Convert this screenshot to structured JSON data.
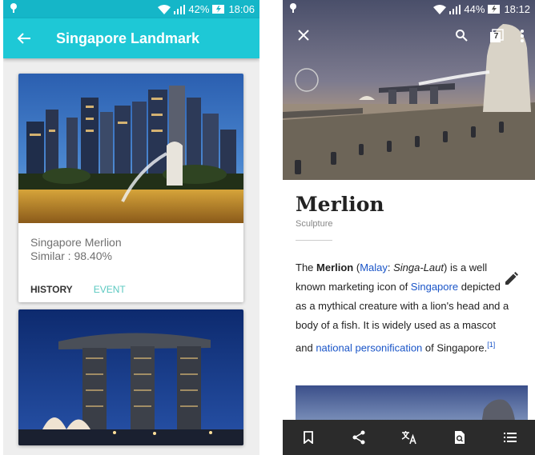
{
  "left_screen": {
    "status": {
      "signal_text": "42%",
      "time": "18:06"
    },
    "appbar": {
      "title": "Singapore Landmark",
      "back_icon": "arrow-back-icon"
    },
    "cards": [
      {
        "name": "Singapore Merlion",
        "similarity": "Similar : 98.40%",
        "actions": [
          "HISTORY",
          "EVENT"
        ]
      },
      {
        "photo": "marina-bay-sands"
      }
    ],
    "colors": {
      "appbar": "#1ec8d6",
      "statusbar": "#15b6c8",
      "event_text": "#5ac8c0"
    }
  },
  "right_screen": {
    "status": {
      "signal_text": "44%",
      "time": "18:12"
    },
    "top_icons": [
      "close-icon",
      "search-icon",
      "tabs-icon",
      "more-icon"
    ],
    "tabs_count": "7",
    "article": {
      "title": "Merlion",
      "subtitle": "Sculpture",
      "body": {
        "p1": "The ",
        "bold": "Merlion",
        "p2": " (",
        "link_malay": "Malay",
        "p3": ": ",
        "italic": "Singa-Laut",
        "p4": ") is a well known marketing icon of ",
        "link_singapore": "Singapore",
        "p5": " depicted as a mythical creature with a lion's head and a body of a fish. It is widely used as a mascot and ",
        "link_national": "national personification",
        "p6": " of Singapore.",
        "ref": "[1]"
      }
    },
    "bottom_bar": [
      "bookmark-icon",
      "share-icon",
      "translate-icon",
      "find-in-page-icon",
      "contents-icon"
    ],
    "colors": {
      "link": "#1a55c8",
      "bottom_bar": "#2b2b2b"
    }
  }
}
